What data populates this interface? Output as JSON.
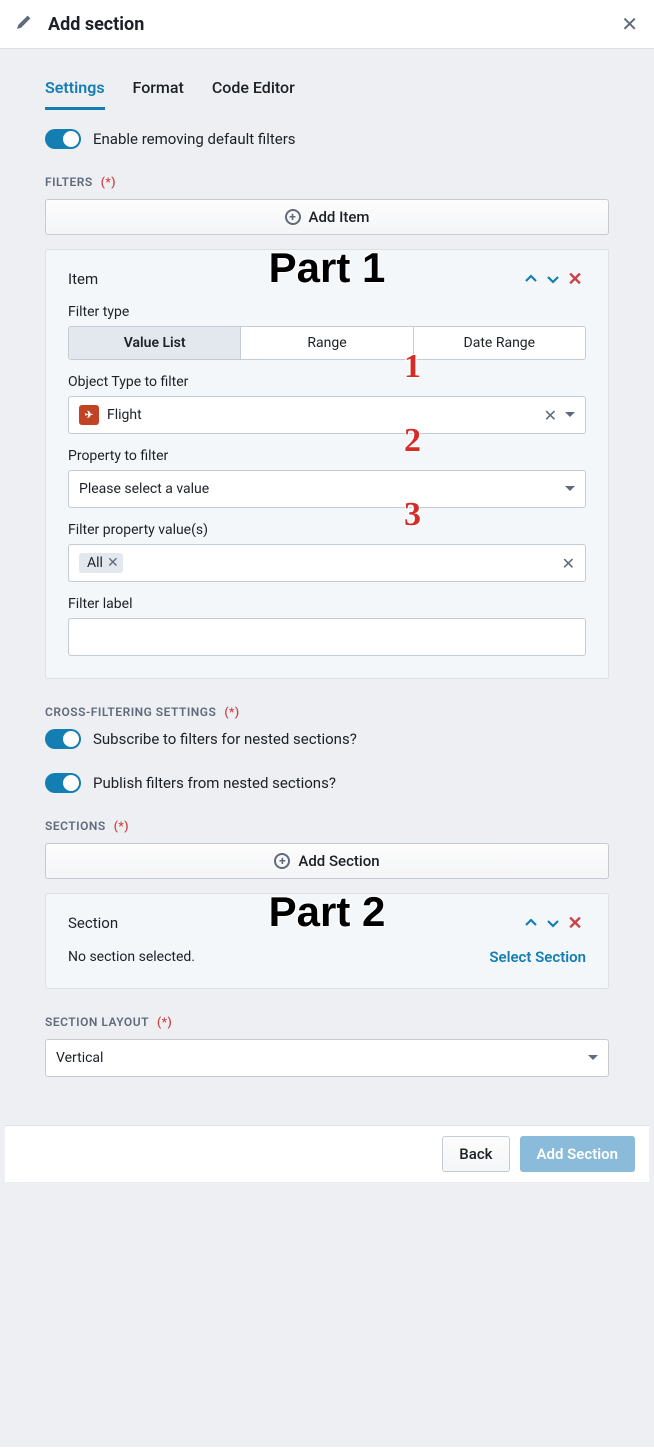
{
  "header": {
    "title": "Add section"
  },
  "tabs": {
    "settings": "Settings",
    "format": "Format",
    "code": "Code Editor"
  },
  "toggle_enable_remove": "Enable removing default filters",
  "filters_label": "FILTERS",
  "add_item": "Add Item",
  "item": {
    "title": "Item",
    "filter_type_label": "Filter type",
    "filter_types": {
      "value_list": "Value List",
      "range": "Range",
      "date_range": "Date Range"
    },
    "object_type_label": "Object Type to filter",
    "object_type_value": "Flight",
    "property_label": "Property to filter",
    "property_placeholder": "Please select a value",
    "filter_values_label": "Filter property value(s)",
    "filter_values_chip": "All",
    "filter_label_label": "Filter label"
  },
  "cross_label": "CROSS-FILTERING SETTINGS",
  "subscribe_label": "Subscribe to filters for nested sections?",
  "publish_label": "Publish filters from nested sections?",
  "sections_label": "SECTIONS",
  "add_section": "Add Section",
  "section": {
    "title": "Section",
    "none": "No section selected.",
    "select": "Select Section"
  },
  "layout_label": "SECTION LAYOUT",
  "layout_value": "Vertical",
  "footer": {
    "back": "Back",
    "add": "Add Section"
  },
  "annotations": {
    "part1": "Part 1",
    "part2": "Part 2",
    "n1": "1",
    "n2": "2",
    "n3": "3"
  }
}
